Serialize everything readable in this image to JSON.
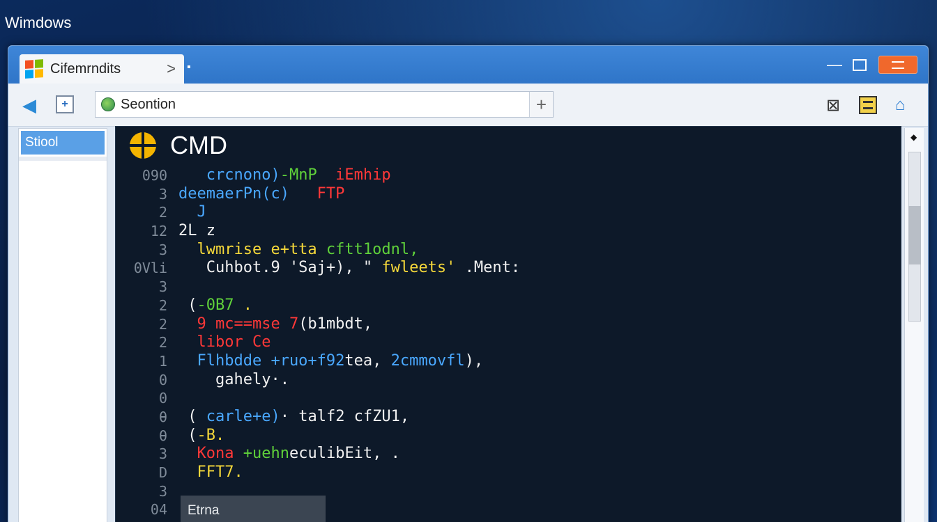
{
  "desktop": {
    "title": "Wimdows"
  },
  "tab": {
    "label": "Cifemrndits",
    "chevron": ">"
  },
  "toolbar": {
    "address_text": "Seontion",
    "plus": "+"
  },
  "sidebar": {
    "items": [
      {
        "label": "Stiool"
      }
    ]
  },
  "console": {
    "title": "CMD",
    "line_numbers": [
      "090",
      "3",
      "2",
      "12",
      "3",
      "0Vli",
      "3",
      "2",
      "2",
      "2",
      "1",
      "0",
      "0",
      "θ",
      "θ",
      "3",
      "D",
      "3",
      "04"
    ],
    "lines": [
      [
        {
          "t": "   crcnono)",
          "c": "blue"
        },
        {
          "t": "-MnP",
          "c": "green"
        },
        {
          "t": "  iEmhip",
          "c": "red"
        }
      ],
      [
        {
          "t": "deemaerPn(c) ",
          "c": "blue"
        },
        {
          "t": "  FTP",
          "c": "red"
        }
      ],
      [
        {
          "t": "  J",
          "c": "blue"
        }
      ],
      [
        {
          "t": "2L z",
          "c": "white"
        }
      ],
      [
        {
          "t": "  lwmrise e+tta ",
          "c": "yellow"
        },
        {
          "t": "cftt1odnl,",
          "c": "green"
        }
      ],
      [
        {
          "t": "   Cuhbot.9 'Saj+), \" ",
          "c": "white"
        },
        {
          "t": "fwleets'",
          "c": "yellow"
        },
        {
          "t": " .Ment:",
          "c": "white"
        }
      ],
      [],
      [
        {
          "t": " (",
          "c": "white"
        },
        {
          "t": "-0B7",
          "c": "green"
        },
        {
          "t": " .",
          "c": "yellow"
        }
      ],
      [
        {
          "t": "  9 mc==mse 7",
          "c": "red"
        },
        {
          "t": "(b1mbdt,",
          "c": "white"
        }
      ],
      [
        {
          "t": "  libor Ce",
          "c": "red"
        }
      ],
      [
        {
          "t": "  Flhbdde +ruo+f92",
          "c": "blue"
        },
        {
          "t": "tea,",
          "c": "white"
        },
        {
          "t": " 2cmmovfl",
          "c": "blue"
        },
        {
          "t": "),",
          "c": "white"
        }
      ],
      [
        {
          "t": "    gahely·.",
          "c": "white"
        }
      ],
      [],
      [
        {
          "t": " (",
          "c": "white"
        },
        {
          "t": " carle+e)",
          "c": "blue"
        },
        {
          "t": "· talf2 cfZU1,",
          "c": "white"
        }
      ],
      [
        {
          "t": " (",
          "c": "white"
        },
        {
          "t": "-B.",
          "c": "yellow"
        }
      ],
      [
        {
          "t": "  Kona",
          "c": "red"
        },
        {
          "t": " +uehn",
          "c": "green"
        },
        {
          "t": "eculibEit,",
          "c": "white"
        },
        {
          "t": " .",
          "c": "white"
        }
      ],
      [
        {
          "t": "  FFT7.",
          "c": "yellow"
        }
      ]
    ],
    "bottom_box": "Etrna"
  },
  "colors": {
    "blue": "#4aa8ff",
    "green": "#5fd03a",
    "red": "#ff3838",
    "white": "#f1f1f1",
    "yellow": "#f5d83a"
  },
  "icons": [
    "windows-logo",
    "chevron-right-icon",
    "back-arrow-icon",
    "page-icon",
    "globe-icon",
    "plus-icon",
    "close-x-icon",
    "calendar-icon",
    "home-icon",
    "minimize-icon",
    "maximize-icon",
    "close-icon",
    "cmd-logo"
  ]
}
